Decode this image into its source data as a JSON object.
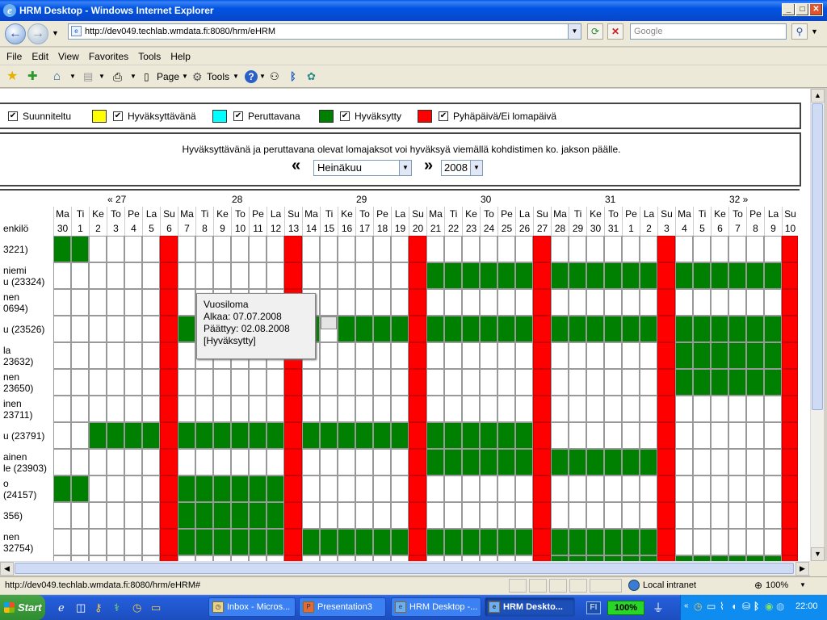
{
  "window": {
    "title": "HRM Desktop - Windows Internet Explorer"
  },
  "address": {
    "url": "http://dev049.techlab.wmdata.fi:8080/hrm/eHRM",
    "search_placeholder": "Google"
  },
  "menu": [
    "File",
    "Edit",
    "View",
    "Favorites",
    "Tools",
    "Help"
  ],
  "toolbar": {
    "page": "Page",
    "tools": "Tools"
  },
  "legend": [
    {
      "label": "Suunniteltu",
      "color": "#ffffff"
    },
    {
      "label": "Hyväksyttävänä",
      "color": "#ffff00"
    },
    {
      "label": "Peruttavana",
      "color": "#00ffff"
    },
    {
      "label": "Hyväksytty",
      "color": "#008000"
    },
    {
      "label": "Pyhäpäivä/Ei lomapäivä",
      "color": "#ff0000"
    }
  ],
  "info": {
    "text": "Hyväksyttävänä ja peruttavana olevat lomajaksot voi hyväksyä viemällä kohdistimen ko. jakson päälle.",
    "prev": "«",
    "next": "»",
    "month": "Heinäkuu",
    "year": "2008"
  },
  "calendar": {
    "column_header": "enkilö",
    "weeks": [
      {
        "label": "« 27",
        "start": 0
      },
      {
        "label": "28",
        "start": 7
      },
      {
        "label": "29",
        "start": 14
      },
      {
        "label": "30",
        "start": 21
      },
      {
        "label": "31",
        "start": 28
      },
      {
        "label": "32 »",
        "start": 35
      }
    ],
    "days": [
      [
        "Ma",
        "30",
        0
      ],
      [
        "Ti",
        "1",
        0
      ],
      [
        "Ke",
        "2",
        0
      ],
      [
        "To",
        "3",
        0
      ],
      [
        "Pe",
        "4",
        0
      ],
      [
        "La",
        "5",
        0
      ],
      [
        "Su",
        "6",
        1
      ],
      [
        "Ma",
        "7",
        0
      ],
      [
        "Ti",
        "8",
        0
      ],
      [
        "Ke",
        "9",
        0
      ],
      [
        "To",
        "10",
        0
      ],
      [
        "Pe",
        "11",
        0
      ],
      [
        "La",
        "12",
        0
      ],
      [
        "Su",
        "13",
        1
      ],
      [
        "Ma",
        "14",
        0
      ],
      [
        "Ti",
        "15",
        0
      ],
      [
        "Ke",
        "16",
        0
      ],
      [
        "To",
        "17",
        0
      ],
      [
        "Pe",
        "18",
        0
      ],
      [
        "La",
        "19",
        0
      ],
      [
        "Su",
        "20",
        1
      ],
      [
        "Ma",
        "21",
        0
      ],
      [
        "Ti",
        "22",
        0
      ],
      [
        "Ke",
        "23",
        0
      ],
      [
        "To",
        "24",
        0
      ],
      [
        "Pe",
        "25",
        0
      ],
      [
        "La",
        "26",
        0
      ],
      [
        "Su",
        "27",
        1
      ],
      [
        "Ma",
        "28",
        0
      ],
      [
        "Ti",
        "29",
        0
      ],
      [
        "Ke",
        "30",
        0
      ],
      [
        "To",
        "31",
        0
      ],
      [
        "Pe",
        "1",
        0
      ],
      [
        "La",
        "2",
        0
      ],
      [
        "Su",
        "3",
        1
      ],
      [
        "Ma",
        "4",
        0
      ],
      [
        "Ti",
        "5",
        0
      ],
      [
        "Ke",
        "6",
        0
      ],
      [
        "To",
        "7",
        0
      ],
      [
        "Pe",
        "8",
        0
      ],
      [
        "La",
        "9",
        0
      ],
      [
        "Su",
        "10",
        1
      ]
    ],
    "rows": [
      {
        "name": [
          "3221)"
        ],
        "green": [
          [
            0,
            1
          ]
        ]
      },
      {
        "name": [
          "niemi",
          "u (23324)"
        ],
        "green": [
          [
            21,
            40
          ]
        ]
      },
      {
        "name": [
          "nen",
          "0694)"
        ],
        "green": []
      },
      {
        "name": [
          "u (23526)"
        ],
        "green": [
          [
            7,
            14
          ],
          [
            16,
            40
          ]
        ]
      },
      {
        "name": [
          "la",
          "23632)"
        ],
        "green": [
          [
            35,
            40
          ]
        ]
      },
      {
        "name": [
          "nen",
          "23650)"
        ],
        "green": [
          [
            35,
            40
          ]
        ]
      },
      {
        "name": [
          "inen",
          "23711)"
        ],
        "green": []
      },
      {
        "name": [
          "u (23791)"
        ],
        "green": [
          [
            2,
            26
          ]
        ]
      },
      {
        "name": [
          "ainen",
          "le (23903)"
        ],
        "green": [
          [
            21,
            33
          ]
        ]
      },
      {
        "name": [
          "o",
          "(24157)"
        ],
        "green": [
          [
            0,
            1
          ],
          [
            7,
            12
          ]
        ]
      },
      {
        "name": [
          "356)"
        ],
        "green": [
          [
            7,
            12
          ]
        ]
      },
      {
        "name": [
          "nen",
          "32754)"
        ],
        "green": [
          [
            7,
            33
          ]
        ]
      },
      {
        "name": [
          "a"
        ],
        "green": [
          [
            28,
            40
          ]
        ]
      }
    ]
  },
  "tooltip": {
    "title": "Vuosiloma",
    "start": "Alkaa: 07.07.2008",
    "end": "Päättyy: 02.08.2008",
    "status": "[Hyväksytty]"
  },
  "status": {
    "url": "http://dev049.techlab.wmdata.fi:8080/hrm/eHRM#",
    "zone": "Local intranet",
    "zoom": "100%"
  },
  "taskbar": {
    "start": "Start",
    "tasks": [
      "Inbox - Micros...",
      "Presentation3",
      "HRM Desktop -...",
      "HRM Deskto..."
    ],
    "lang": "FI",
    "battery": "100%",
    "clock": "22:00"
  }
}
